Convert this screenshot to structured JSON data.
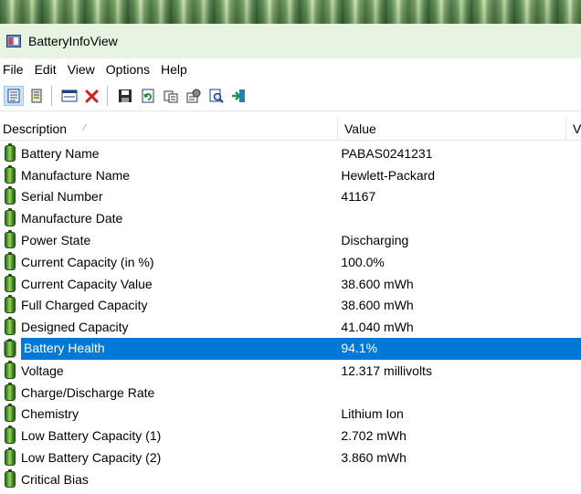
{
  "window": {
    "title": "BatteryInfoView"
  },
  "menu": [
    "File",
    "Edit",
    "View",
    "Options",
    "Help"
  ],
  "toolbar": {
    "icons": [
      "properties-icon",
      "html-report-icon",
      "options-icon",
      "close-icon",
      "save-icon",
      "refresh-icon",
      "copy-icon",
      "properties-dialog-icon",
      "find-icon",
      "exit-icon"
    ]
  },
  "columns": {
    "description": "Description",
    "value": "Value",
    "extra": "V"
  },
  "rows": [
    {
      "label": "Battery Name",
      "value": "PABAS0241231"
    },
    {
      "label": "Manufacture Name",
      "value": "Hewlett-Packard"
    },
    {
      "label": "Serial Number",
      "value": "41167"
    },
    {
      "label": "Manufacture Date",
      "value": ""
    },
    {
      "label": "Power State",
      "value": "Discharging"
    },
    {
      "label": "Current Capacity (in %)",
      "value": "100.0%"
    },
    {
      "label": "Current Capacity Value",
      "value": "38.600 mWh"
    },
    {
      "label": "Full Charged Capacity",
      "value": "38.600 mWh"
    },
    {
      "label": "Designed Capacity",
      "value": "41.040 mWh"
    },
    {
      "label": "Battery Health",
      "value": "94.1%"
    },
    {
      "label": "Voltage",
      "value": "12.317 millivolts"
    },
    {
      "label": "Charge/Discharge Rate",
      "value": ""
    },
    {
      "label": "Chemistry",
      "value": "Lithium Ion"
    },
    {
      "label": "Low Battery Capacity (1)",
      "value": "2.702 mWh"
    },
    {
      "label": "Low Battery Capacity (2)",
      "value": "3.860 mWh"
    },
    {
      "label": "Critical Bias",
      "value": ""
    }
  ],
  "selected_row": "Battery Health",
  "colors": {
    "selection": "#0078d7",
    "titlebar": "#e6f4e1"
  }
}
